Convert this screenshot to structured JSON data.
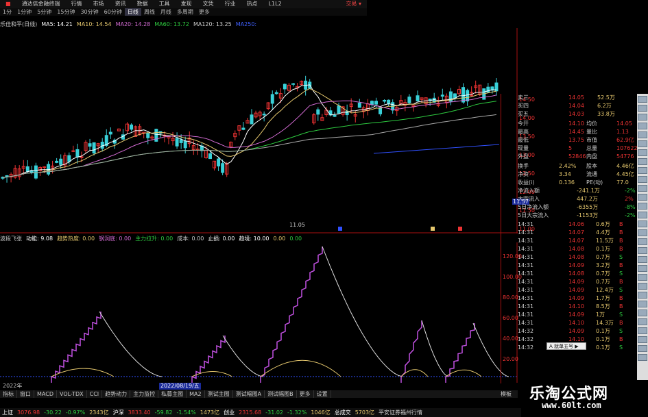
{
  "window": {
    "title": "通达信金融终端",
    "close_label": "交易 ▾"
  },
  "menu": [
    "行情",
    "市场",
    "资讯",
    "数据",
    "工具",
    "发现",
    "文凭",
    "行业",
    "热点",
    "L1L2"
  ],
  "toolbar": {
    "items": [
      "1分",
      "1分钟",
      "5分钟",
      "15分钟",
      "30分钟",
      "60分钟",
      "日线",
      "周线",
      "月线",
      "多周期",
      "更多"
    ],
    "active": "日线"
  },
  "ma_legend": [
    {
      "label": "乐佳和平(日线)",
      "color": "#cccccc"
    },
    {
      "label": "MA5: 14.21",
      "color": "#ffffff"
    },
    {
      "label": "MA10: 14.54",
      "color": "#e6c86e"
    },
    {
      "label": "MA20: 14.28",
      "color": "#d36bd3"
    },
    {
      "label": "MA60: 13.72",
      "color": "#2ecc40"
    },
    {
      "label": "MA120: 13.25",
      "color": "#cccccc"
    },
    {
      "label": "MA250:",
      "color": "#4060ff"
    }
  ],
  "price_axis": [
    "14.50",
    "14.00",
    "13.50",
    "13.00",
    "12.50",
    "12.00",
    "11.50",
    "11.00"
  ],
  "price_marker": "11.57",
  "low_marker": "11.05",
  "indicator_legend": [
    {
      "label": "波段飞张",
      "color": "#cccccc"
    },
    {
      "label": "动能: 9.08",
      "color": "#ffffff"
    },
    {
      "label": "趋势热度: 0.00",
      "color": "#e6c86e"
    },
    {
      "label": "钢洞底: 0.00",
      "color": "#d36bd3"
    },
    {
      "label": "主力拉升: 0.00",
      "color": "#2ecc40"
    },
    {
      "label": "成本: 0.00",
      "color": "#cccccc"
    },
    {
      "label": "止损: 0.00",
      "color": "#ffffff"
    },
    {
      "label": "趋境: 10.00",
      "color": "#ffffff"
    },
    {
      "label": "0.00",
      "color": "#e6c86e"
    },
    {
      "label": "0.00",
      "color": "#2ecc40"
    }
  ],
  "indicator_axis": [
    "120.00",
    "100.00",
    "80.00",
    "60.00",
    "40.00",
    "20.00"
  ],
  "date_label": "2022/08/19/五",
  "year_label": "2022年",
  "quote": {
    "orderbook": [
      {
        "k": "卖三",
        "p": "14.05",
        "v": "52.5万"
      },
      {
        "k": "买四",
        "p": "14.04",
        "v": "6.2万"
      },
      {
        "k": "买五",
        "p": "14.03",
        "v": "33.8万"
      }
    ],
    "stats": [
      {
        "a": "今开",
        "b": "14.10",
        "c": "均价",
        "d": "14.05"
      },
      {
        "a": "最高",
        "b": "14.45",
        "c": "量比",
        "d": "1.13"
      },
      {
        "a": "最低",
        "b": "13.75",
        "c": "市值",
        "d": "62.9亿"
      },
      {
        "a": "现量",
        "b": "5",
        "c": "总量",
        "d": "107622"
      },
      {
        "a": "外盘",
        "b": "52846",
        "c": "内盘",
        "d": "54776"
      }
    ],
    "finance": [
      {
        "a": "换手",
        "b": "2.42%",
        "c": "股本",
        "d": "4.46亿"
      },
      {
        "a": "净资",
        "b": "3.34",
        "c": "流通",
        "d": "4.45亿"
      },
      {
        "a": "收益(i)",
        "b": "0.136",
        "c": "PE(动)",
        "d": "77.0"
      }
    ],
    "flows": [
      {
        "k": "净流入额",
        "v": "-241.1万",
        "p": "-2%"
      },
      {
        "k": "大宗流入",
        "v": "447.2万",
        "p": "2%"
      },
      {
        "k": "5日净流入额",
        "v": "-6355万",
        "p": "-8%"
      },
      {
        "k": "5日大宗流入",
        "v": "-1153万",
        "p": "-2%"
      }
    ],
    "ticks": [
      {
        "t": "14:31",
        "p": "14.06",
        "v": "0.6万",
        "s": "B"
      },
      {
        "t": "14:31",
        "p": "14.07",
        "v": "4.4万",
        "s": "B"
      },
      {
        "t": "14:31",
        "p": "14.07",
        "v": "11.5万",
        "s": "B"
      },
      {
        "t": "14:31",
        "p": "14.08",
        "v": "0.1万",
        "s": "B"
      },
      {
        "t": "14:31",
        "p": "14.08",
        "v": "0.7万",
        "s": "S"
      },
      {
        "t": "14:31",
        "p": "14.09",
        "v": "3.2万",
        "s": "B"
      },
      {
        "t": "14:31",
        "p": "14.08",
        "v": "0.7万",
        "s": "S"
      },
      {
        "t": "14:31",
        "p": "14.09",
        "v": "0.7万",
        "s": "B"
      },
      {
        "t": "14:31",
        "p": "14.09",
        "v": "12.4万",
        "s": "S"
      },
      {
        "t": "14:31",
        "p": "14.09",
        "v": "1.7万",
        "s": "B"
      },
      {
        "t": "14:31",
        "p": "14.10",
        "v": "8.5万",
        "s": "B"
      },
      {
        "t": "14:31",
        "p": "14.09",
        "v": "1万",
        "s": "S"
      },
      {
        "t": "14:31",
        "p": "14.10",
        "v": "14.3万",
        "s": "B"
      },
      {
        "t": "14:32",
        "p": "14.09",
        "v": "0.1万",
        "s": "S"
      },
      {
        "t": "14:32",
        "p": "14.10",
        "v": "0.1万",
        "s": "B"
      },
      {
        "t": "14:32",
        "p": "14.09",
        "v": "0.1万",
        "s": "S"
      }
    ]
  },
  "popup_label": "A 就单五号 ▶",
  "bottom_tabs": [
    "指标",
    "窗口",
    "MACD",
    "VOL-TDX",
    "CCI",
    "趋势动力",
    "主力监控",
    "私募主图",
    "MA2",
    "测试主图",
    "测试幅图A",
    "测试幅图B",
    "更多",
    "设置"
  ],
  "bottom_right": "模板",
  "status": [
    {
      "t": "上证",
      "c": "#ffffff"
    },
    {
      "t": "3076.98",
      "c": "#e33"
    },
    {
      "t": "-30.22",
      "c": "#2ecc40"
    },
    {
      "t": "-0.97%",
      "c": "#2ecc40"
    },
    {
      "t": "2343亿",
      "c": "#e6c86e"
    },
    {
      "t": "沪深",
      "c": "#ffffff"
    },
    {
      "t": "3833.40",
      "c": "#e33"
    },
    {
      "t": "-59.82",
      "c": "#2ecc40"
    },
    {
      "t": "-1.54%",
      "c": "#2ecc40"
    },
    {
      "t": "1473亿",
      "c": "#e6c86e"
    },
    {
      "t": "创业",
      "c": "#ffffff"
    },
    {
      "t": "2315.68",
      "c": "#e33"
    },
    {
      "t": "-31.02",
      "c": "#2ecc40"
    },
    {
      "t": "-1.32%",
      "c": "#2ecc40"
    },
    {
      "t": "1046亿",
      "c": "#e6c86e"
    },
    {
      "t": "总成交",
      "c": "#ffffff"
    },
    {
      "t": "5703亿",
      "c": "#e6c86e"
    },
    {
      "t": "平安证券福州行情",
      "c": "#cccccc"
    }
  ],
  "watermark": {
    "line1": "乐淘公式网",
    "line2": "www.60lt.com"
  }
}
